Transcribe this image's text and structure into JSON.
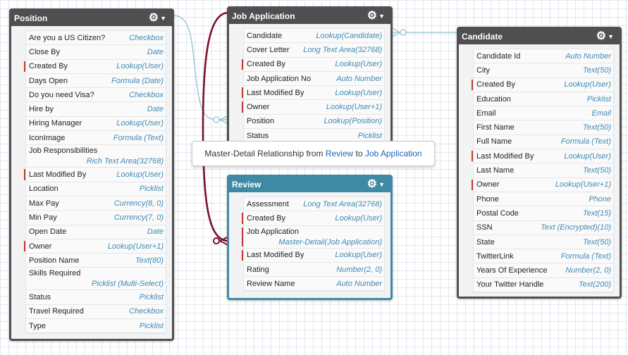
{
  "tooltip": {
    "prefix": "Master-Detail Relationship from ",
    "from": "Review",
    "middle": " to ",
    "to": "Job Application"
  },
  "objects": {
    "position": {
      "title": "Position",
      "fields": [
        {
          "name": "Are you a US Citizen?",
          "type": "Checkbox"
        },
        {
          "name": "Close By",
          "type": "Date"
        },
        {
          "name": "Created By",
          "type": "Lookup(User)",
          "required": true
        },
        {
          "name": "Days Open",
          "type": "Formula (Date)"
        },
        {
          "name": "Do you need Visa?",
          "type": "Checkbox"
        },
        {
          "name": "Hire by",
          "type": "Date"
        },
        {
          "name": "Hiring Manager",
          "type": "Lookup(User)"
        },
        {
          "name": "IconImage",
          "type": "Formula (Text)"
        },
        {
          "name": "Job Responsibilities",
          "type": "Rich Text Area(32768)",
          "wrap": true
        },
        {
          "name": "Last Modified By",
          "type": "Lookup(User)",
          "required": true
        },
        {
          "name": "Location",
          "type": "Picklist"
        },
        {
          "name": "Max Pay",
          "type": "Currency(8, 0)"
        },
        {
          "name": "Min Pay",
          "type": "Currency(7, 0)"
        },
        {
          "name": "Open Date",
          "type": "Date"
        },
        {
          "name": "Owner",
          "type": "Lookup(User+1)",
          "required": true
        },
        {
          "name": "Position Name",
          "type": "Text(80)"
        },
        {
          "name": "Skills Required",
          "type": "Picklist (Multi-Select)",
          "wrap": true
        },
        {
          "name": "Status",
          "type": "Picklist"
        },
        {
          "name": "Travel Required",
          "type": "Checkbox"
        },
        {
          "name": "Type",
          "type": "Picklist"
        }
      ]
    },
    "job_application": {
      "title": "Job Application",
      "fields": [
        {
          "name": "Candidate",
          "type": "Lookup(Candidate)"
        },
        {
          "name": "Cover Letter",
          "type": "Long Text Area(32768)"
        },
        {
          "name": "Created By",
          "type": "Lookup(User)",
          "required": true
        },
        {
          "name": "Job Application No",
          "type": "Auto Number"
        },
        {
          "name": "Last Modified By",
          "type": "Lookup(User)",
          "required": true
        },
        {
          "name": "Owner",
          "type": "Lookup(User+1)",
          "required": true
        },
        {
          "name": "Position",
          "type": "Lookup(Position)"
        },
        {
          "name": "Status",
          "type": "Picklist"
        }
      ]
    },
    "review": {
      "title": "Review",
      "fields": [
        {
          "name": "Assessment",
          "type": "Long Text Area(32768)"
        },
        {
          "name": "Created By",
          "type": "Lookup(User)",
          "required": true
        },
        {
          "name": "Job Application",
          "type": "Master-Detail(Job Application)",
          "wrap": true,
          "required": true
        },
        {
          "name": "Last Modified By",
          "type": "Lookup(User)",
          "required": true
        },
        {
          "name": "Rating",
          "type": "Number(2, 0)"
        },
        {
          "name": "Review Name",
          "type": "Auto Number"
        }
      ]
    },
    "candidate": {
      "title": "Candidate",
      "fields": [
        {
          "name": "Candidate Id",
          "type": "Auto Number"
        },
        {
          "name": "City",
          "type": "Text(50)"
        },
        {
          "name": "Created By",
          "type": "Lookup(User)",
          "required": true
        },
        {
          "name": "Education",
          "type": "Picklist"
        },
        {
          "name": "Email",
          "type": "Email"
        },
        {
          "name": "First Name",
          "type": "Text(50)"
        },
        {
          "name": "Full Name",
          "type": "Formula (Text)"
        },
        {
          "name": "Last Modified By",
          "type": "Lookup(User)",
          "required": true
        },
        {
          "name": "Last Name",
          "type": "Text(50)"
        },
        {
          "name": "Owner",
          "type": "Lookup(User+1)",
          "required": true
        },
        {
          "name": "Phone",
          "type": "Phone"
        },
        {
          "name": "Postal Code",
          "type": "Text(15)"
        },
        {
          "name": "SSN",
          "type": "Text (Encrypted)(10)"
        },
        {
          "name": "State",
          "type": "Text(50)"
        },
        {
          "name": "TwitterLink",
          "type": "Formula (Text)"
        },
        {
          "name": "Years Of Experience",
          "type": "Number(2, 0)"
        },
        {
          "name": "Your Twitter Handle",
          "type": "Text(200)"
        }
      ]
    }
  },
  "colors": {
    "card_border": "#4f4f52",
    "review_border": "#3e8aa4",
    "master_detail_line": "#7a0f2e",
    "lookup_line": "#8fc3cf",
    "field_type": "#3f8ab5",
    "required_marker": "#c23934"
  }
}
